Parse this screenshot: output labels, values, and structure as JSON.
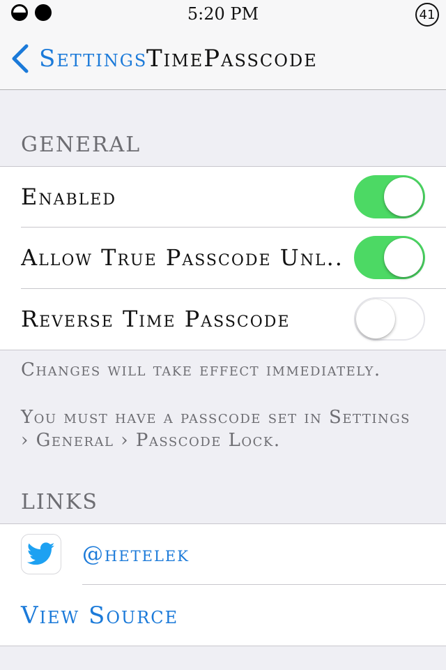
{
  "status_bar": {
    "time": "5:20 PM",
    "badge": "41"
  },
  "nav": {
    "back_label": "Settings",
    "title": "TimePasscode"
  },
  "general": {
    "header": "GENERAL",
    "rows": [
      {
        "label": "Enabled",
        "toggle": "on"
      },
      {
        "label": "Allow True Passcode Unl...",
        "toggle": "on"
      },
      {
        "label": "Reverse Time Passcode",
        "toggle": "off"
      }
    ],
    "footer_1": "Changes will take effect immediately.",
    "footer_2": "You must have a passcode set in Settings › General › Passcode Lock."
  },
  "links": {
    "header": "LINKS",
    "items": [
      {
        "label": "@hetelek",
        "icon": "twitter-bird-icon"
      },
      {
        "label": "View Source"
      }
    ]
  },
  "colors": {
    "accent": "#1b7ad9",
    "toggle_on": "#4cd964",
    "background": "#efeff4"
  }
}
